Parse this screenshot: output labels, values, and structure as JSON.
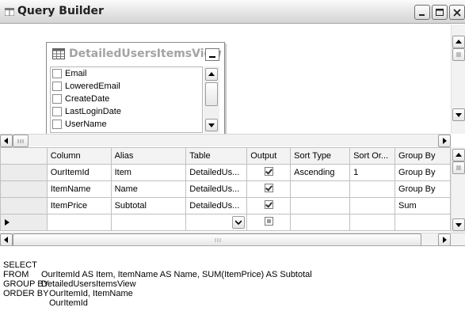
{
  "window": {
    "title": "Query Builder"
  },
  "diagram": {
    "table_name": "DetailedUsersItemsView",
    "columns": [
      "Email",
      "LoweredEmail",
      "CreateDate",
      "LastLoginDate",
      "UserName"
    ]
  },
  "grid": {
    "headers": [
      "Column",
      "Alias",
      "Table",
      "Output",
      "Sort Type",
      "Sort Or...",
      "Group By"
    ],
    "rows": [
      {
        "column": "OurItemId",
        "alias": "Item",
        "table": "DetailedUs...",
        "output": true,
        "sort_type": "Ascending",
        "sort_order": "1",
        "group_by": "Group By"
      },
      {
        "column": "ItemName",
        "alias": "Name",
        "table": "DetailedUs...",
        "output": true,
        "sort_type": "",
        "sort_order": "",
        "group_by": "Group By"
      },
      {
        "column": "ItemPrice",
        "alias": "Subtotal",
        "table": "DetailedUs...",
        "output": true,
        "sort_type": "",
        "sort_order": "",
        "group_by": "Sum"
      }
    ]
  },
  "sql": {
    "select_kw": "SELECT",
    "select_val": "OurItemId AS Item, ItemName AS Name, SUM(ItemPrice) AS Subtotal",
    "from_kw": "FROM",
    "from_val": "DetailedUsersItemsView",
    "group_kw": "GROUP BY",
    "group_val": "OurItemId, ItemName",
    "order_kw": "ORDER BY",
    "order_val": "OurItemId"
  },
  "icons": {
    "app": "query-builder-icon",
    "table": "table-icon"
  }
}
